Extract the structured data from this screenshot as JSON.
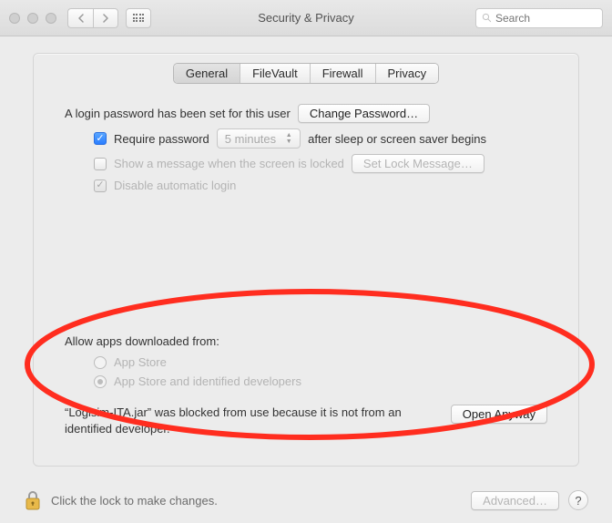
{
  "window": {
    "title": "Security & Privacy",
    "search_placeholder": "Search"
  },
  "tabs": [
    "General",
    "FileVault",
    "Firewall",
    "Privacy"
  ],
  "active_tab_index": 0,
  "login_password": {
    "text": "A login password has been set for this user",
    "change_button": "Change Password…"
  },
  "require_password": {
    "checked": true,
    "label_before": "Require password",
    "delay_value": "5 minutes",
    "label_after": "after sleep or screen saver begins"
  },
  "show_message": {
    "checked": false,
    "label": "Show a message when the screen is locked",
    "button": "Set Lock Message…"
  },
  "disable_auto_login": {
    "checked": true,
    "label": "Disable automatic login"
  },
  "download_section": {
    "label": "Allow apps downloaded from:",
    "options": [
      "App Store",
      "App Store and identified developers"
    ],
    "selected_index": 1
  },
  "blocked": {
    "message": "“Logisim-ITA.jar” was blocked from use because it is not from an identified developer.",
    "button": "Open Anyway"
  },
  "footer": {
    "lock_text": "Click the lock to make changes.",
    "advanced": "Advanced…",
    "help": "?"
  }
}
